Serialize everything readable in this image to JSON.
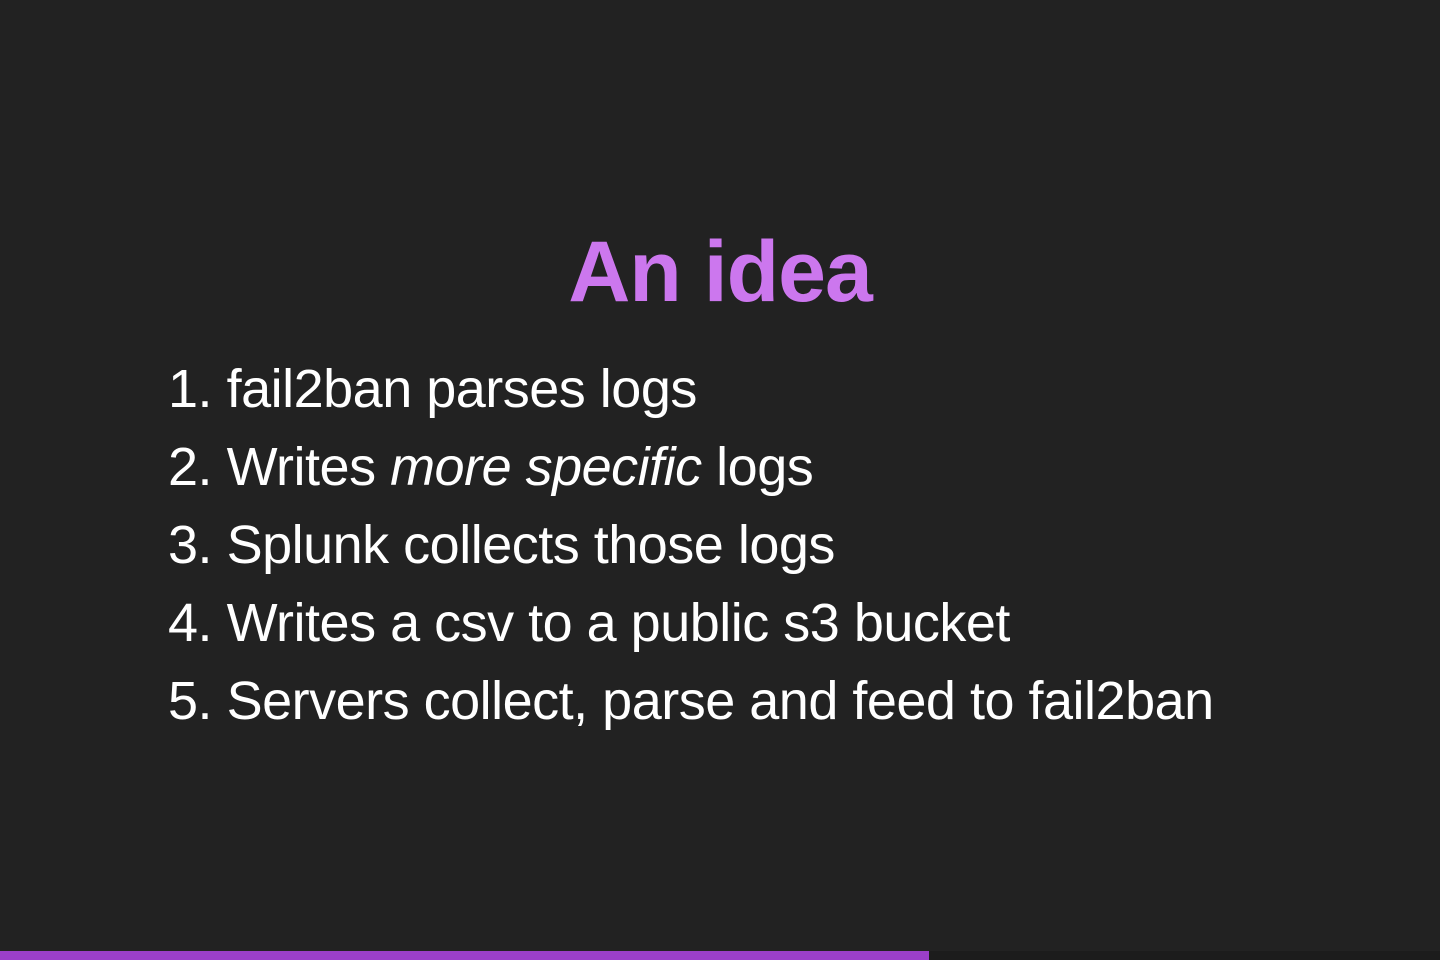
{
  "slide": {
    "title": "An idea",
    "items": [
      {
        "number": "1.",
        "before": "fail2ban parses logs",
        "emphasis": "",
        "after": ""
      },
      {
        "number": "2.",
        "before": "Writes ",
        "emphasis": "more specific",
        "after": " logs"
      },
      {
        "number": "3.",
        "before": "Splunk collects those logs",
        "emphasis": "",
        "after": ""
      },
      {
        "number": "4.",
        "before": "Writes a csv to a public s3 bucket",
        "emphasis": "",
        "after": ""
      },
      {
        "number": "5.",
        "before": "Servers collect, parse and feed to fail2ban",
        "emphasis": "",
        "after": ""
      }
    ]
  },
  "progress": {
    "fraction": 0.645,
    "color": "#9b3fc9"
  },
  "colors": {
    "background": "#222222",
    "title": "#cc77ee",
    "text": "#ffffff"
  }
}
